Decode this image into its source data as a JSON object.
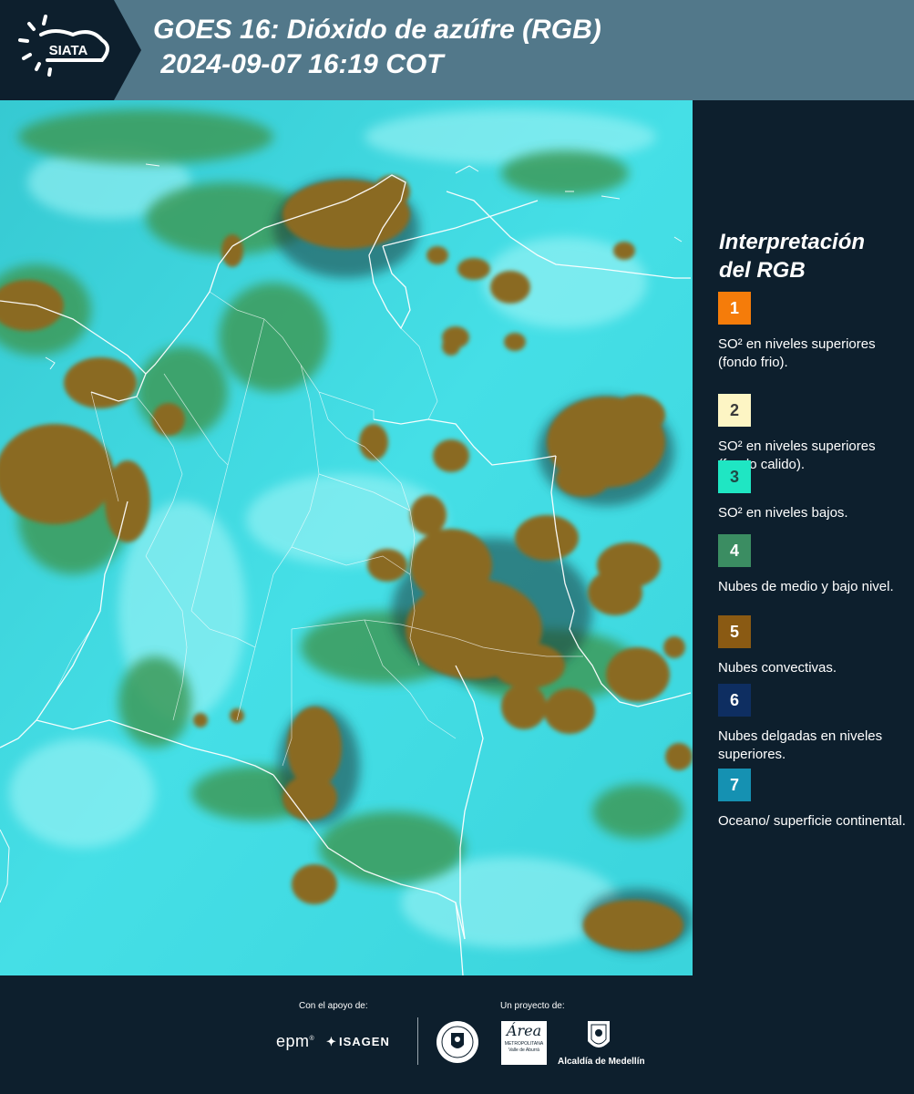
{
  "header": {
    "logo_text": "SIATA",
    "title_line1": "GOES 16: Dióxido de azúfre (RGB)",
    "title_line2": " 2024-09-07 16:19 COT"
  },
  "legend": {
    "title_line1": "Interpretación",
    "title_line2": "del RGB",
    "items": [
      {
        "number": "1",
        "text": "SO² en niveles superiores (fondo frio).",
        "color": "#f57c0a",
        "num_color": "#ffffff"
      },
      {
        "number": "2",
        "text": "SO² en niveles superiores (fondo calido).",
        "color": "#fdf5c4",
        "num_color": "#3a3a3a"
      },
      {
        "number": "3",
        "text": "SO² en niveles bajos.",
        "color": "#1fe6c3",
        "num_color": "#1e4a46"
      },
      {
        "number": "4",
        "text": "Nubes de medio y bajo nivel.",
        "color": "#3b8d62",
        "num_color": "#ffffff"
      },
      {
        "number": "5",
        "text": "Nubes convectivas.",
        "color": "#8a5a13",
        "num_color": "#ffffff"
      },
      {
        "number": "6",
        "text": "Nubes delgadas en niveles superiores.",
        "color": "#0e2e61",
        "num_color": "#ffffff"
      },
      {
        "number": "7",
        "text": "Oceano/ superficie continental.",
        "color": "#1591b2",
        "num_color": "#ffffff"
      }
    ]
  },
  "footer": {
    "support_label": "Con el apoyo de:",
    "project_label": "Un proyecto de:",
    "epm": "epm",
    "isagen": "ISAGEN",
    "area_metro": "Área",
    "area_metro_sub": "METROPOLITANA",
    "area_metro_sub2": "Valle de Aburrá",
    "alcaldia": "Alcaldía de Medellín"
  },
  "colors": {
    "header_bg": "#52788a",
    "panel_bg": "#0d1f2d",
    "cyan_clear": "#3fe0e6",
    "green_low_cloud": "#3d9b5a",
    "brown_convective": "#8a6a24"
  }
}
